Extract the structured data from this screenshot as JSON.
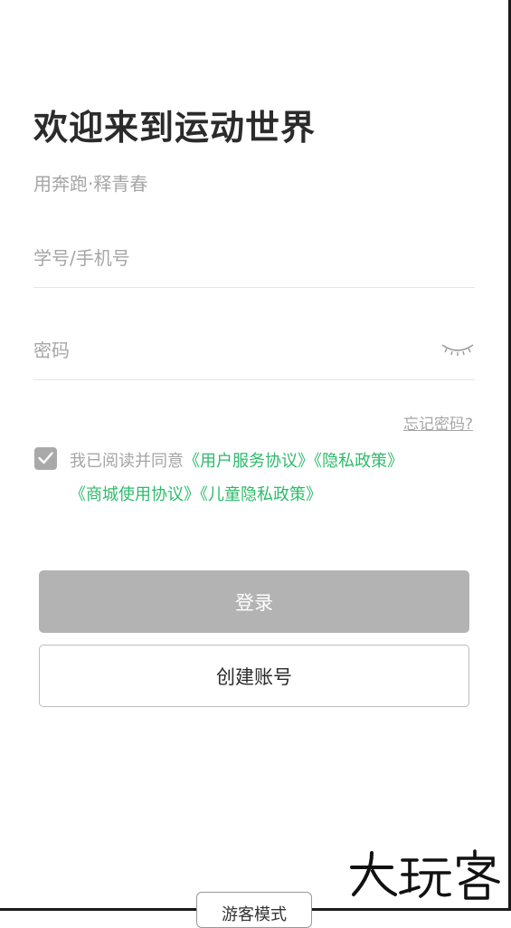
{
  "header": {
    "title": "欢迎来到运动世界",
    "subtitle": "用奔跑·释青春"
  },
  "form": {
    "username_placeholder": "学号/手机号",
    "password_placeholder": "密码",
    "password_toggle_icon": "eye-closed-icon",
    "forgot_password": "忘记密码?"
  },
  "agreement": {
    "checked": true,
    "text": "我已阅读并同意",
    "links": [
      "《用户服务协议》",
      "《隐私政策》",
      "《商城使用协议》",
      "《儿童隐私政策》"
    ],
    "link_color": "#2dbb6a"
  },
  "buttons": {
    "login_label": "登录",
    "register_label": "创建账号"
  },
  "bottom_tab": {
    "label": "游客模式"
  },
  "watermark": {
    "text": "大玩客"
  },
  "colors": {
    "accent": "#2dbb6a",
    "login_disabled_bg": "#b3b3b3",
    "placeholder": "#a6a6a6"
  }
}
